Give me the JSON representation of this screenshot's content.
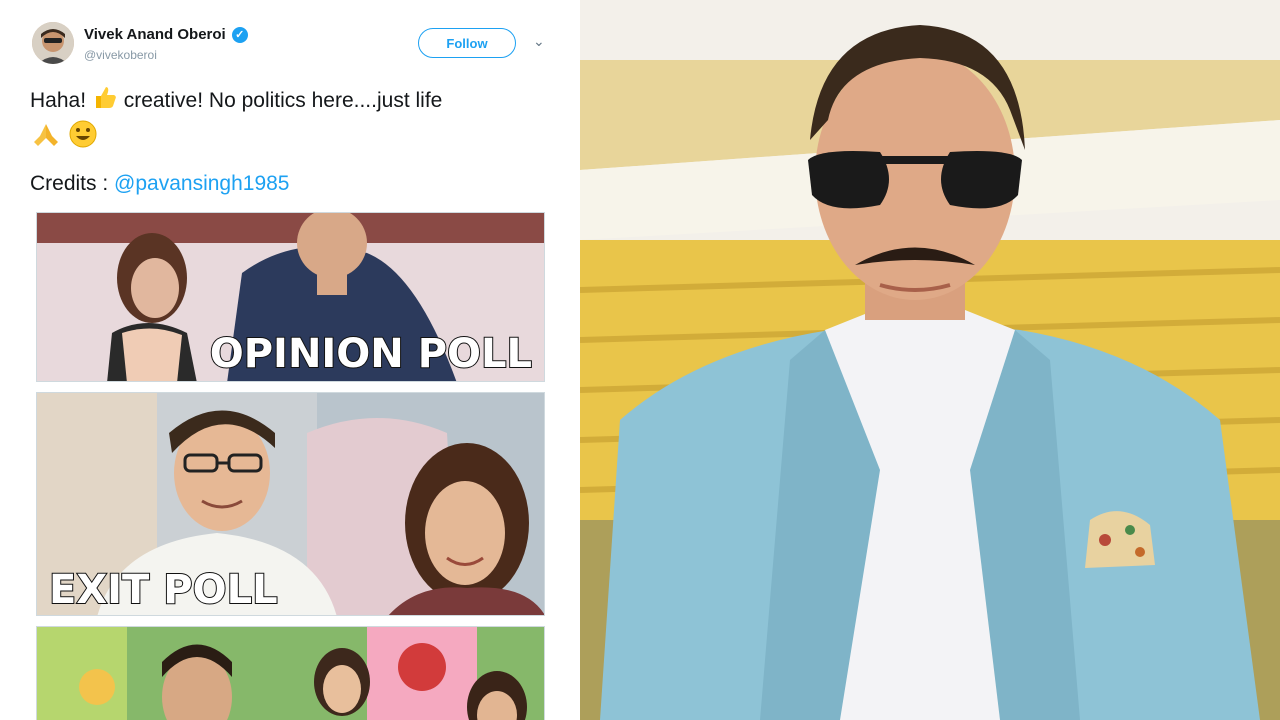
{
  "tweet": {
    "author_name": "Vivek Anand Oberoi",
    "handle": "@vivekoberoi",
    "follow_label": "Follow",
    "verified_glyph": "✓",
    "text_line1_a": "Haha! ",
    "text_line1_b": " creative! No politics here....just life",
    "credits_label": "Credits : ",
    "credits_mention": "@pavansingh1985"
  },
  "meme": {
    "panel1_caption": "OPINION POLL",
    "panel2_caption": "EXIT POLL"
  },
  "icons": {
    "verified": "verified-badge-icon",
    "thumbs_up": "thumbs-up-emoji",
    "folded_hands": "folded-hands-emoji",
    "smile": "smiling-face-emoji",
    "more": "chevron-down-icon"
  },
  "colors": {
    "twitter_blue": "#1da1f2",
    "jacket": "#8ec3d6",
    "stadium_seats": "#e9c54a"
  }
}
